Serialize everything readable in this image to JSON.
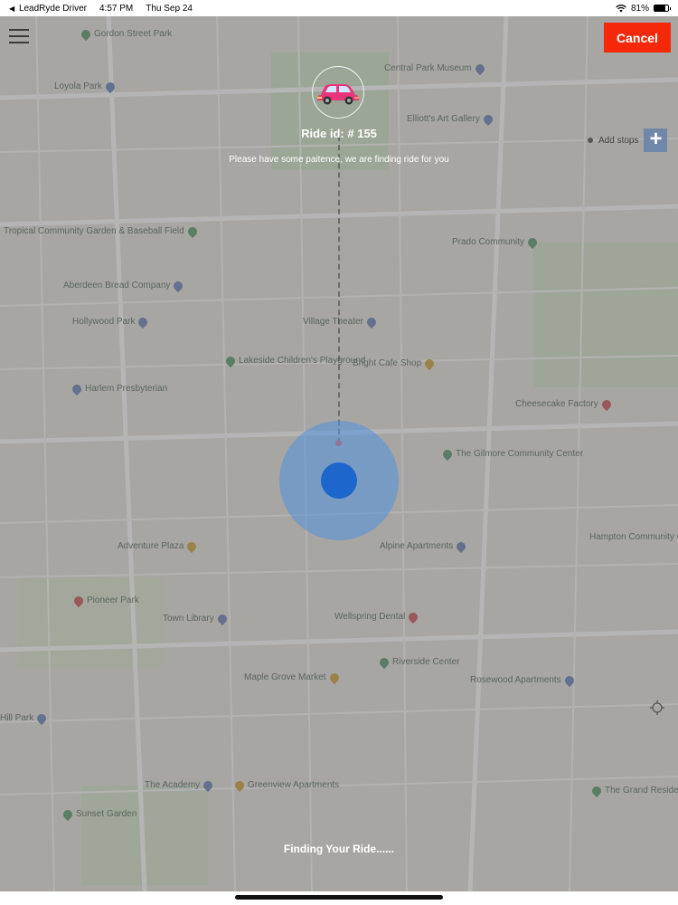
{
  "status_bar": {
    "back_app": "LeadRyde Driver",
    "time": "4:57 PM",
    "date": "Thu Sep 24",
    "battery": "81%",
    "battery_level": 0.81
  },
  "header": {
    "cancel_label": "Cancel"
  },
  "add_stops": {
    "label": "Add stops",
    "plus": "+"
  },
  "ride": {
    "id_label": "Ride id: # 155",
    "message": "Please have some paitence, we are finding ride for you",
    "status": "Finding Your Ride......"
  },
  "map": {
    "pois": [
      {
        "label": "Gordon Street Park",
        "kind": "green"
      },
      {
        "label": "Loyola Park",
        "kind": "blue"
      },
      {
        "label": "Elliott's Art Gallery",
        "kind": "blue"
      },
      {
        "label": "Central Park Museum",
        "kind": "blue"
      },
      {
        "label": "Tropical Community Garden & Baseball Field",
        "kind": "green"
      },
      {
        "label": "Prado Community",
        "kind": "green"
      },
      {
        "label": "Aberdeen Bread Company",
        "kind": "blue"
      },
      {
        "label": "Cheesecake Factory",
        "kind": "red"
      },
      {
        "label": "Hollywood Park",
        "kind": "blue"
      },
      {
        "label": "Village Theater",
        "kind": "blue"
      },
      {
        "label": "Lakeside Children's Playground",
        "kind": "green"
      },
      {
        "label": "Bright Cafe Shop",
        "kind": "orange"
      },
      {
        "label": "Adventure Plaza",
        "kind": "orange"
      },
      {
        "label": "Pioneer Park",
        "kind": "red"
      },
      {
        "label": "Harlem Presbyterian",
        "kind": "blue"
      },
      {
        "label": "The Gilmore Community Center",
        "kind": "green"
      },
      {
        "label": "Alpine Apartments",
        "kind": "blue"
      },
      {
        "label": "Town Library",
        "kind": "blue"
      },
      {
        "label": "Hampton Community College",
        "kind": "green"
      },
      {
        "label": "Wellspring Dental",
        "kind": "red"
      },
      {
        "label": "Maple Grove Market",
        "kind": "orange"
      },
      {
        "label": "Hill Park",
        "kind": "blue"
      },
      {
        "label": "The Academy",
        "kind": "blue"
      },
      {
        "label": "Greenview Apartments",
        "kind": "orange"
      },
      {
        "label": "The Grand Residences",
        "kind": "green"
      },
      {
        "label": "Sunset Garden",
        "kind": "green"
      },
      {
        "label": "Riverside Center",
        "kind": "green"
      },
      {
        "label": "Rosewood Apartments",
        "kind": "blue"
      }
    ]
  },
  "colors": {
    "cancel_bg": "#f5280a",
    "location_blue": "#1c66cc",
    "car_pink": "#e8347a"
  },
  "icons": {
    "menu": "hamburger-menu-icon",
    "car": "car-icon",
    "add": "plus-icon",
    "locate": "locate-icon"
  }
}
